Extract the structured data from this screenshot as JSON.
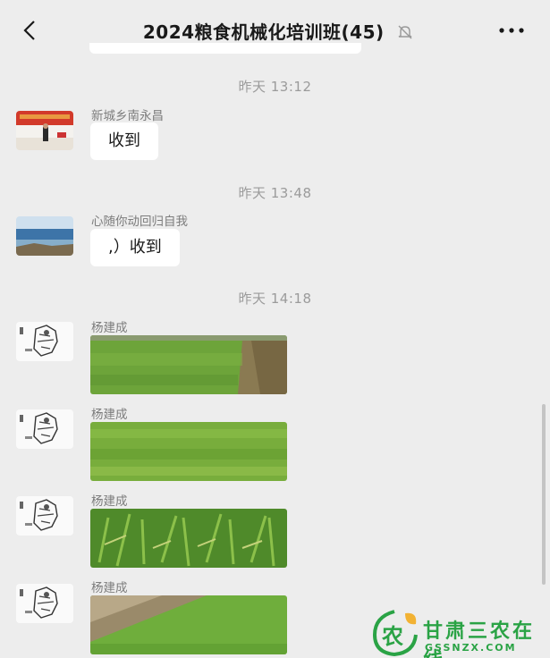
{
  "header": {
    "title": "2024粮食机械化培训班(45)",
    "back_icon": "back-chevron-icon",
    "mute_icon": "muted-bell-icon",
    "more_icon": "more-dots-icon"
  },
  "messages": [
    {
      "time": "昨天 13:12",
      "sender": "新城乡南永昌",
      "text": "收到"
    },
    {
      "time": "昨天 13:48",
      "sender": "心随你动回归自我",
      "text": ",）收到"
    },
    {
      "time": "昨天 14:18",
      "sender": "杨建成"
    },
    {
      "sender": "杨建成"
    },
    {
      "sender": "杨建成"
    },
    {
      "sender": "杨建成"
    }
  ],
  "watermark": {
    "logo_letter": "农",
    "name": "甘肃三农在线",
    "domain": "GSSNZX.COM"
  },
  "colors": {
    "background": "#ededed",
    "bubble": "#ffffff",
    "watermark_green": "#2aa345"
  }
}
